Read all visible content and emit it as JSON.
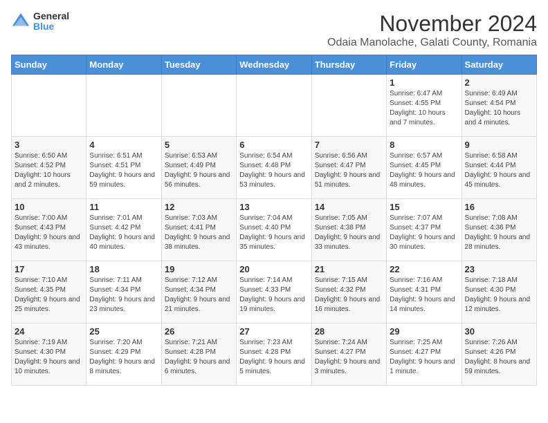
{
  "logo": {
    "general": "General",
    "blue": "Blue"
  },
  "title": "November 2024",
  "subtitle": "Odaia Manolache, Galati County, Romania",
  "days_of_week": [
    "Sunday",
    "Monday",
    "Tuesday",
    "Wednesday",
    "Thursday",
    "Friday",
    "Saturday"
  ],
  "weeks": [
    [
      {
        "day": "",
        "info": ""
      },
      {
        "day": "",
        "info": ""
      },
      {
        "day": "",
        "info": ""
      },
      {
        "day": "",
        "info": ""
      },
      {
        "day": "",
        "info": ""
      },
      {
        "day": "1",
        "info": "Sunrise: 6:47 AM\nSunset: 4:55 PM\nDaylight: 10 hours and 7 minutes."
      },
      {
        "day": "2",
        "info": "Sunrise: 6:49 AM\nSunset: 4:54 PM\nDaylight: 10 hours and 4 minutes."
      }
    ],
    [
      {
        "day": "3",
        "info": "Sunrise: 6:50 AM\nSunset: 4:52 PM\nDaylight: 10 hours and 2 minutes."
      },
      {
        "day": "4",
        "info": "Sunrise: 6:51 AM\nSunset: 4:51 PM\nDaylight: 9 hours and 59 minutes."
      },
      {
        "day": "5",
        "info": "Sunrise: 6:53 AM\nSunset: 4:49 PM\nDaylight: 9 hours and 56 minutes."
      },
      {
        "day": "6",
        "info": "Sunrise: 6:54 AM\nSunset: 4:48 PM\nDaylight: 9 hours and 53 minutes."
      },
      {
        "day": "7",
        "info": "Sunrise: 6:56 AM\nSunset: 4:47 PM\nDaylight: 9 hours and 51 minutes."
      },
      {
        "day": "8",
        "info": "Sunrise: 6:57 AM\nSunset: 4:45 PM\nDaylight: 9 hours and 48 minutes."
      },
      {
        "day": "9",
        "info": "Sunrise: 6:58 AM\nSunset: 4:44 PM\nDaylight: 9 hours and 45 minutes."
      }
    ],
    [
      {
        "day": "10",
        "info": "Sunrise: 7:00 AM\nSunset: 4:43 PM\nDaylight: 9 hours and 43 minutes."
      },
      {
        "day": "11",
        "info": "Sunrise: 7:01 AM\nSunset: 4:42 PM\nDaylight: 9 hours and 40 minutes."
      },
      {
        "day": "12",
        "info": "Sunrise: 7:03 AM\nSunset: 4:41 PM\nDaylight: 9 hours and 38 minutes."
      },
      {
        "day": "13",
        "info": "Sunrise: 7:04 AM\nSunset: 4:40 PM\nDaylight: 9 hours and 35 minutes."
      },
      {
        "day": "14",
        "info": "Sunrise: 7:05 AM\nSunset: 4:38 PM\nDaylight: 9 hours and 33 minutes."
      },
      {
        "day": "15",
        "info": "Sunrise: 7:07 AM\nSunset: 4:37 PM\nDaylight: 9 hours and 30 minutes."
      },
      {
        "day": "16",
        "info": "Sunrise: 7:08 AM\nSunset: 4:36 PM\nDaylight: 9 hours and 28 minutes."
      }
    ],
    [
      {
        "day": "17",
        "info": "Sunrise: 7:10 AM\nSunset: 4:35 PM\nDaylight: 9 hours and 25 minutes."
      },
      {
        "day": "18",
        "info": "Sunrise: 7:11 AM\nSunset: 4:34 PM\nDaylight: 9 hours and 23 minutes."
      },
      {
        "day": "19",
        "info": "Sunrise: 7:12 AM\nSunset: 4:34 PM\nDaylight: 9 hours and 21 minutes."
      },
      {
        "day": "20",
        "info": "Sunrise: 7:14 AM\nSunset: 4:33 PM\nDaylight: 9 hours and 19 minutes."
      },
      {
        "day": "21",
        "info": "Sunrise: 7:15 AM\nSunset: 4:32 PM\nDaylight: 9 hours and 16 minutes."
      },
      {
        "day": "22",
        "info": "Sunrise: 7:16 AM\nSunset: 4:31 PM\nDaylight: 9 hours and 14 minutes."
      },
      {
        "day": "23",
        "info": "Sunrise: 7:18 AM\nSunset: 4:30 PM\nDaylight: 9 hours and 12 minutes."
      }
    ],
    [
      {
        "day": "24",
        "info": "Sunrise: 7:19 AM\nSunset: 4:30 PM\nDaylight: 9 hours and 10 minutes."
      },
      {
        "day": "25",
        "info": "Sunrise: 7:20 AM\nSunset: 4:29 PM\nDaylight: 9 hours and 8 minutes."
      },
      {
        "day": "26",
        "info": "Sunrise: 7:21 AM\nSunset: 4:28 PM\nDaylight: 9 hours and 6 minutes."
      },
      {
        "day": "27",
        "info": "Sunrise: 7:23 AM\nSunset: 4:28 PM\nDaylight: 9 hours and 5 minutes."
      },
      {
        "day": "28",
        "info": "Sunrise: 7:24 AM\nSunset: 4:27 PM\nDaylight: 9 hours and 3 minutes."
      },
      {
        "day": "29",
        "info": "Sunrise: 7:25 AM\nSunset: 4:27 PM\nDaylight: 9 hours and 1 minute."
      },
      {
        "day": "30",
        "info": "Sunrise: 7:26 AM\nSunset: 4:26 PM\nDaylight: 8 hours and 59 minutes."
      }
    ]
  ]
}
